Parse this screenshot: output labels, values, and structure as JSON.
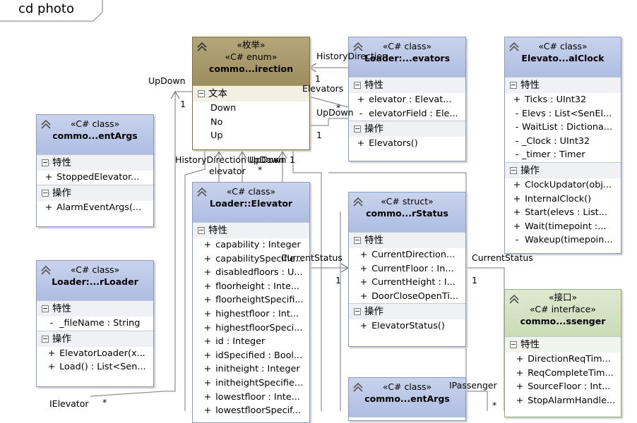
{
  "diagram": {
    "title": "cd photo"
  },
  "classes": {
    "enum_direction": {
      "stereotypes": [
        "«枚举»",
        "«C# enum»"
      ],
      "name": "commo...irection",
      "section": "文本",
      "items": [
        "Down",
        "No",
        "Up"
      ]
    },
    "loader_elevators": {
      "stereotype": "«C# class»",
      "name": "Loader:...evators",
      "attr_header": "特性",
      "attrs": [
        {
          "vis": "+",
          "text": "elevator : Elevat..."
        },
        {
          "vis": "-",
          "text": "elevatorField : Ele..."
        }
      ],
      "op_header": "操作",
      "ops": [
        {
          "vis": "+",
          "text": "Elevators()"
        }
      ]
    },
    "internal_clock": {
      "stereotype": "«C# class»",
      "name": "Elevato...alClock",
      "attr_header": "特性",
      "attrs": [
        {
          "vis": "+",
          "text": "Ticks : UInt32"
        },
        {
          "vis": "-",
          "text": "Elevs : List<SenEl..."
        },
        {
          "vis": "-",
          "text": "WaitList : Dictiona..."
        },
        {
          "vis": "-",
          "text": "_Clock : UInt32"
        },
        {
          "vis": "-",
          "text": "_timer : Timer"
        }
      ],
      "op_header": "操作",
      "ops": [
        {
          "vis": "+",
          "text": "ClockUpdator(obj..."
        },
        {
          "vis": "+",
          "text": "InternalClock()"
        },
        {
          "vis": "+",
          "text": "Start(elevs : List..."
        },
        {
          "vis": "+",
          "text": "Wait(timepoint :..."
        },
        {
          "vis": "-",
          "text": "Wakeup(timepoin..."
        }
      ]
    },
    "alarm_args": {
      "stereotype": "«C# class»",
      "name": "commo...entArgs",
      "attr_header": "特性",
      "attrs": [
        {
          "vis": "+",
          "text": "StoppedElevator..."
        }
      ],
      "op_header": "操作",
      "ops": [
        {
          "vis": "+",
          "text": "AlarmEventArgs(..."
        }
      ]
    },
    "elevator": {
      "stereotype": "«C# class»",
      "name": "Loader::Elevator",
      "attr_header": "特性",
      "attrs": [
        {
          "vis": "+",
          "text": "capability : Integer"
        },
        {
          "vis": "+",
          "text": "capabilitySpecifie..."
        },
        {
          "vis": "+",
          "text": "disabledfloors : U..."
        },
        {
          "vis": "+",
          "text": "floorheight : Inte..."
        },
        {
          "vis": "+",
          "text": "floorheightSpecifi..."
        },
        {
          "vis": "+",
          "text": "highestfloor : Int..."
        },
        {
          "vis": "+",
          "text": "highestfloorSpeci..."
        },
        {
          "vis": "+",
          "text": "id : Integer"
        },
        {
          "vis": "+",
          "text": "idSpecified : Bool..."
        },
        {
          "vis": "+",
          "text": "initheight : Integer"
        },
        {
          "vis": "+",
          "text": "initheightSpecifie..."
        },
        {
          "vis": "+",
          "text": "lowestfloor : Inte..."
        },
        {
          "vis": "+",
          "text": "lowestfloorSpecif..."
        }
      ]
    },
    "elevator_status": {
      "stereotype": "«C# struct»",
      "name": "commo...rStatus",
      "attr_header": "特性",
      "attrs": [
        {
          "vis": "+",
          "text": "CurrentDirection..."
        },
        {
          "vis": "+",
          "text": "CurrentFloor : In..."
        },
        {
          "vis": "+",
          "text": "CurrentHeight : I..."
        },
        {
          "vis": "+",
          "text": "DoorCloseOpenTi..."
        }
      ],
      "op_header": "操作",
      "ops": [
        {
          "vis": "+",
          "text": "ElevatorStatus()"
        }
      ]
    },
    "loader": {
      "stereotype": "«C# class»",
      "name": "Loader:...rLoader",
      "attr_header": "特性",
      "attrs": [
        {
          "vis": "-",
          "text": "_fileName : String"
        }
      ],
      "op_header": "操作",
      "ops": [
        {
          "vis": "+",
          "text": "ElevatorLoader(x..."
        },
        {
          "vis": "+",
          "text": "Load() : List<Sen..."
        }
      ]
    },
    "passenger": {
      "stereotypes": [
        "«接口»",
        "«C# interface»"
      ],
      "name": "commo...ssenger",
      "attr_header": "特性",
      "attrs": [
        {
          "vis": "+",
          "text": "DirectionReqTim..."
        },
        {
          "vis": "+",
          "text": "ReqCompleteTim..."
        },
        {
          "vis": "+",
          "text": "SourceFloor : Int..."
        },
        {
          "vis": "+",
          "text": "StopAlarmHandle..."
        }
      ]
    },
    "request_args": {
      "stereotype": "«C# class»",
      "name": "commo...entArgs"
    }
  },
  "labels": {
    "history_direction": "HistoryDirection",
    "updown_left": "UpDown",
    "elevators": "Elevators",
    "updown_right": "UpDown",
    "star": "*",
    "one": "1",
    "overlap_text": "HistoryDirection UpDown",
    "updown_mid": "UpDown",
    "elevator_role": "elevator",
    "current_status_left": "CurrentStatus",
    "current_status_right": "CurrentStatus",
    "ipassenger": "IPassenger",
    "ielevator": "IElevator"
  }
}
